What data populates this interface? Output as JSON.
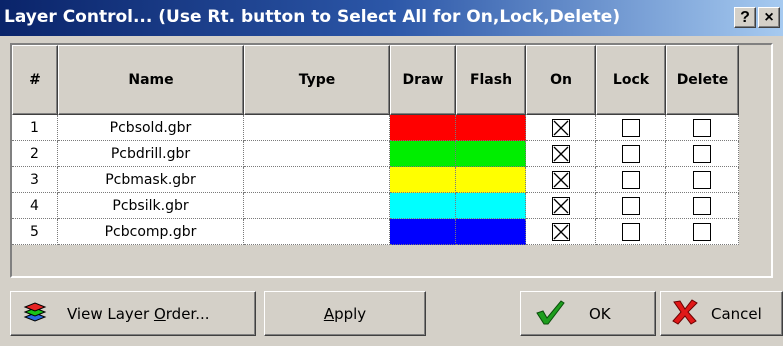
{
  "window": {
    "title": "Layer Control...  (Use Rt. button to Select All for On,Lock,Delete)",
    "help_label": "?",
    "close_label": "×"
  },
  "grid": {
    "headers": [
      "#",
      "Name",
      "Type",
      "Draw",
      "Flash",
      "On",
      "Lock",
      "Delete"
    ],
    "rows": [
      {
        "num": "1",
        "name": "Pcbsold.gbr",
        "type": "",
        "draw_color": "#ff0000",
        "flash_color": "#ff0000",
        "on": true,
        "lock": false,
        "delete": false
      },
      {
        "num": "2",
        "name": "Pcbdrill.gbr",
        "type": "",
        "draw_color": "#00ee00",
        "flash_color": "#00ee00",
        "on": true,
        "lock": false,
        "delete": false
      },
      {
        "num": "3",
        "name": "Pcbmask.gbr",
        "type": "",
        "draw_color": "#ffff00",
        "flash_color": "#ffff00",
        "on": true,
        "lock": false,
        "delete": false
      },
      {
        "num": "4",
        "name": "Pcbsilk.gbr",
        "type": "",
        "draw_color": "#00ffff",
        "flash_color": "#00ffff",
        "on": true,
        "lock": false,
        "delete": false
      },
      {
        "num": "5",
        "name": "Pcbcomp.gbr",
        "type": "",
        "draw_color": "#0000ff",
        "flash_color": "#0000ff",
        "on": true,
        "lock": false,
        "delete": false
      }
    ]
  },
  "buttons": {
    "view_layer_order": "View Layer Order...",
    "apply": "Apply",
    "ok": "OK",
    "cancel": "Cancel"
  },
  "icons": {
    "layers": "layers-icon",
    "ok": "checkmark-icon",
    "cancel": "red-x-icon"
  }
}
